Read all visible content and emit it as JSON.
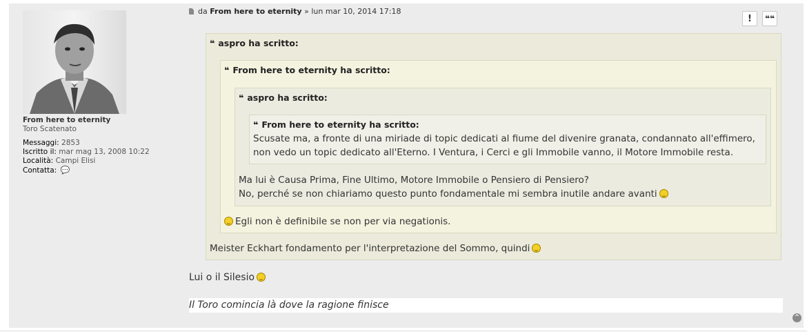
{
  "profile": {
    "username": "From here to eternity",
    "rank": "Toro Scatenato",
    "posts_label": "Messaggi:",
    "posts_value": "2853",
    "joined_label": "Iscritto il:",
    "joined_value": "mar mag 13, 2008 10:22",
    "location_label": "Località:",
    "location_value": "Campi Elisi",
    "contact_label": "Contatta:"
  },
  "post": {
    "by_prefix": "da",
    "author": "From here to eternity",
    "date": "» lun mar 10, 2014 17:18",
    "report_label": "!",
    "quote_label": "❝❝",
    "quotes": [
      {
        "cite": "aspro ha scritto:"
      },
      {
        "cite": "From here to eternity ha scritto:"
      },
      {
        "cite": "aspro ha scritto:"
      },
      {
        "cite": "From here to eternity ha scritto:"
      }
    ],
    "q4_line1": "Scusate ma, a fronte di una miriade di topic dedicati al fiume del divenire granata, condannato all'effimero,",
    "q4_line2": "non vedo un topic dedicato all'Eterno. I Ventura, i Cerci e gli Immobile vanno, il Motore Immobile resta.",
    "q3_line1": "Ma lui è Causa Prima, Fine Ultimo, Motore Immobile o Pensiero di Pensiero?",
    "q3_line2": "No, perché se non chiariamo questo punto fondamentale mi sembra inutile andare avanti",
    "q2_line1": "Egli non è definibile se non per via negationis.",
    "q1_line1": "Meister Eckhart fondamento per l'interpretazione del Sommo, quindi",
    "body_line": "Lui o il Silesio",
    "signature": "Il Toro comincia là dove la ragione finisce"
  },
  "icons": {
    "quote_mark": "❝",
    "smiley": "laughing-smiley-icon",
    "contact": "speech-bubble-icon",
    "up": "back-to-top-icon"
  },
  "colors": {
    "post_bg": "#ececec",
    "quote_bg_outer": "#ebeadb",
    "quote_bg_inner": "#f4f3e0",
    "contact_icon": "#e6a23c"
  }
}
